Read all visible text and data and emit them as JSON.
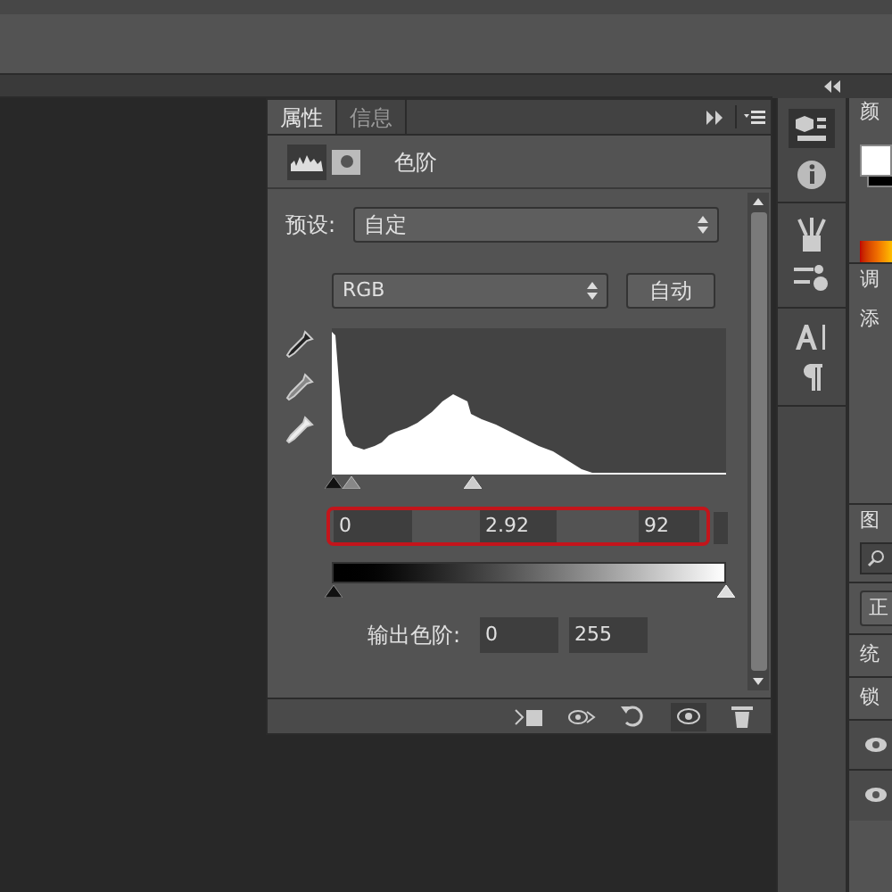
{
  "panel": {
    "tabs": [
      {
        "label": "属性",
        "selected": true
      },
      {
        "label": "信息",
        "selected": false
      }
    ],
    "adjustment_title": "色阶",
    "preset": {
      "label": "预设:",
      "value": "自定"
    },
    "channel": {
      "value": "RGB"
    },
    "auto_button": "自动",
    "input_levels": [
      "0",
      "2.92",
      "92"
    ],
    "output_levels": {
      "label": "输出色阶:",
      "values": [
        "0",
        "255"
      ]
    }
  },
  "right_panel": {
    "color_tab": "颜",
    "adjust_tab": "调",
    "adjust_hint": "添",
    "layers_tab": "图",
    "blend_mode": "正",
    "unify_label": "统",
    "lock_label": "锁"
  }
}
